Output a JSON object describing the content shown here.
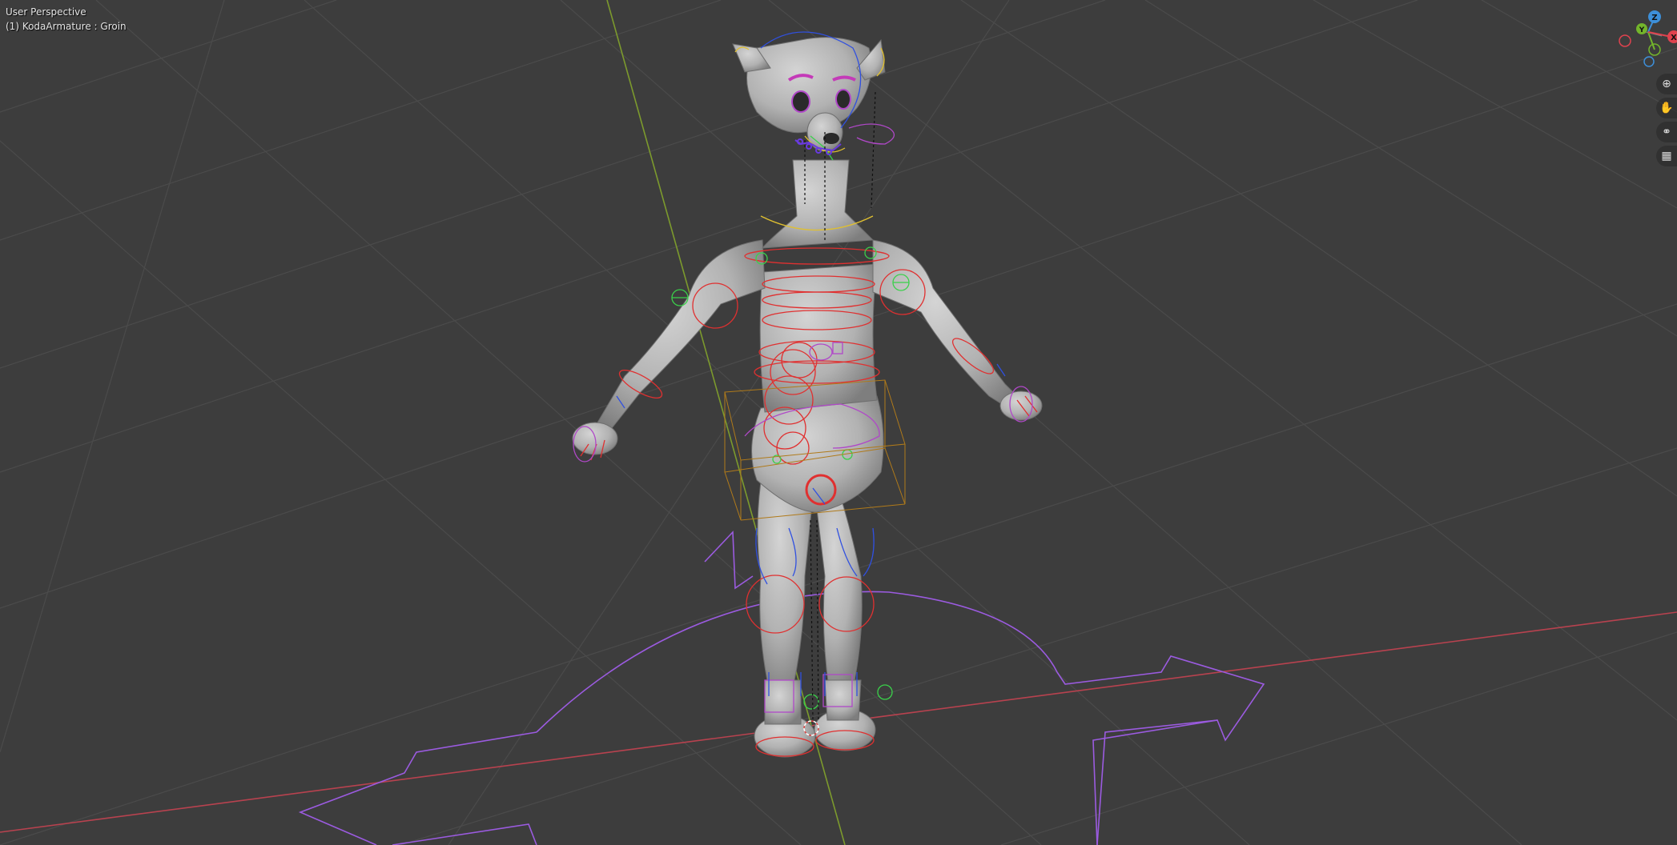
{
  "viewport": {
    "view_name": "User Perspective",
    "object_info": "(1) KodaArmature : Groin"
  },
  "gizmo": {
    "z_label": "Z",
    "y_label": "Y",
    "x_label": "X",
    "colors": {
      "x": "#e0424e",
      "y": "#73b52b",
      "z": "#3d8fd9"
    }
  },
  "nav_buttons": [
    {
      "name": "zoom-icon",
      "glyph": "⊕"
    },
    {
      "name": "hand-pan-icon",
      "glyph": "✋"
    },
    {
      "name": "camera-icon",
      "glyph": "⚭"
    },
    {
      "name": "grid-perspective-icon",
      "glyph": "▦"
    }
  ],
  "colors": {
    "background": "#3d3d3d",
    "grid": "#4a4a4a",
    "x_axis": "#b8424f",
    "y_axis": "#7c9a2d",
    "mesh": "#bdbdbd",
    "bone_red": "#e03030",
    "bone_blue": "#3050e0",
    "bone_green": "#3ad14a",
    "bone_purple": "#b048c8",
    "bone_yellow": "#e0c030"
  }
}
